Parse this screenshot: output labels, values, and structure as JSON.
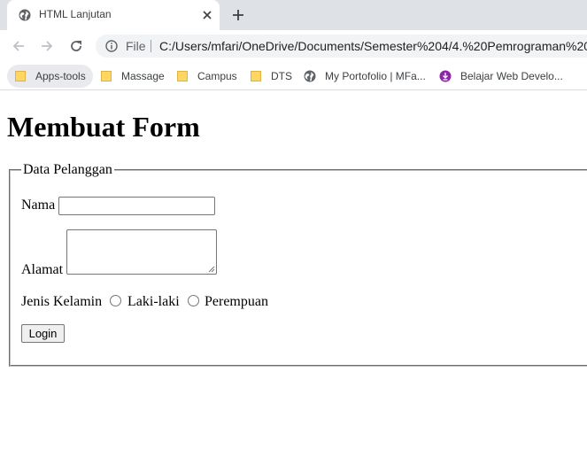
{
  "browser": {
    "tab": {
      "title": "HTML Lanjutan"
    },
    "address": {
      "scheme_label": "File",
      "url": "C:/Users/mfari/OneDrive/Documents/Semester%204/4.%20Pemrograman%20w"
    },
    "bookmarks": [
      {
        "label": "Apps-tools",
        "icon": "folder-icon"
      },
      {
        "label": "Massage",
        "icon": "folder-icon"
      },
      {
        "label": "Campus",
        "icon": "folder-icon"
      },
      {
        "label": "DTS",
        "icon": "folder-icon"
      },
      {
        "label": "My Portofolio | MFa...",
        "icon": "globe-icon"
      },
      {
        "label": "Belajar Web Develo...",
        "icon": "purple-logo-icon"
      }
    ],
    "colors": {
      "folder": "#fdd663",
      "folder_outline": "#e3b341",
      "logo": "#8e24aa"
    }
  },
  "page": {
    "title": "Membuat Form",
    "form": {
      "legend": "Data Pelanggan",
      "nama_label": "Nama",
      "nama_value": "",
      "alamat_label": "Alamat",
      "alamat_value": "",
      "gender_label": "Jenis Kelamin",
      "gender_options": [
        "Laki-laki",
        "Perempuan"
      ],
      "submit_label": "Login"
    }
  }
}
